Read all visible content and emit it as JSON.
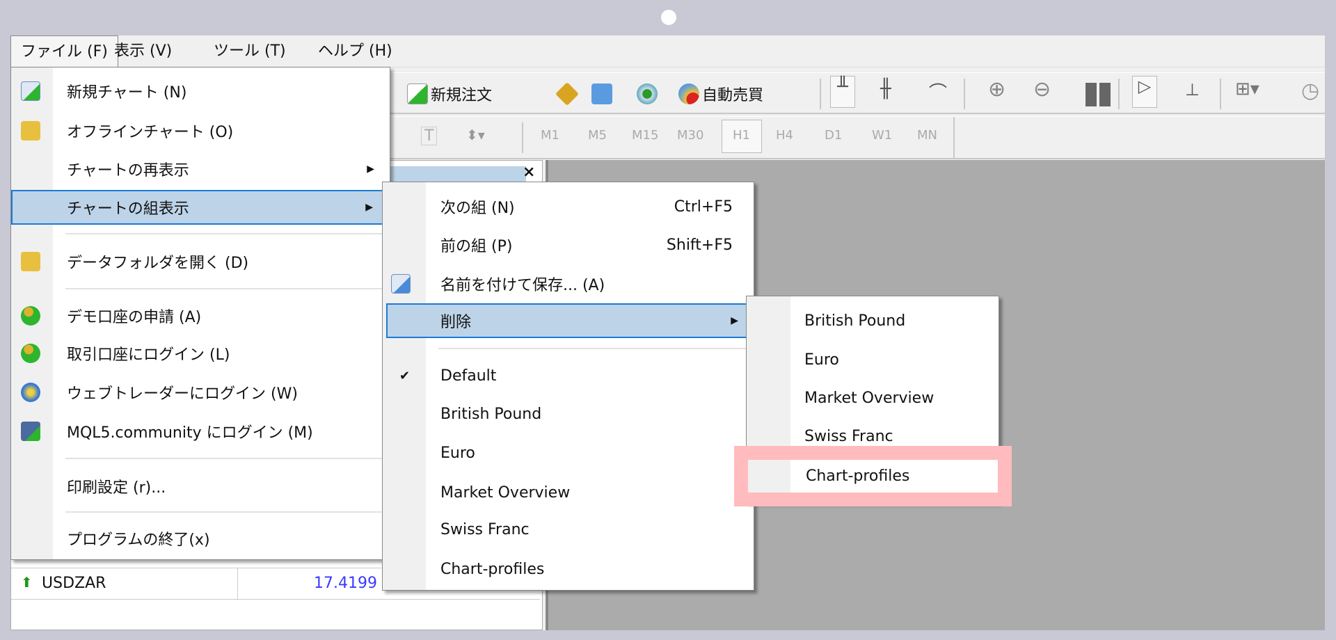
{
  "menubar": {
    "items": [
      "ファイル (F)",
      "表示 (V)",
      "ツール (T)",
      "ヘルプ (H)"
    ]
  },
  "toolbar": {
    "new_order": "新規注文",
    "auto_trade": "自動売買",
    "timeframes": [
      "M1",
      "M5",
      "M15",
      "M30",
      "H1",
      "H4",
      "D1",
      "W1",
      "MN"
    ],
    "active_timeframe": "H1"
  },
  "market_watch": {
    "close": "×",
    "rows": [
      {
        "symbol": "USDZAR",
        "bid": "17.4199",
        "direction": "up"
      }
    ]
  },
  "file_menu": {
    "items": [
      {
        "label": "新規チャート (N)",
        "icon": "new-chart-icon"
      },
      {
        "label": "オフラインチャート (O)",
        "icon": "folder-open-icon"
      },
      {
        "label": "チャートの再表示",
        "submenu": true
      },
      {
        "label": "チャートの組表示",
        "submenu": true,
        "highlighted": true
      },
      {
        "label": "データフォルダを開く (D)",
        "icon": "folder-icon"
      },
      {
        "label": "デモ口座の申請 (A)",
        "icon": "user-add-icon"
      },
      {
        "label": "取引口座にログイン (L)",
        "icon": "user-login-icon"
      },
      {
        "label": "ウェブトレーダーにログイン (W)",
        "icon": "globe-login-icon"
      },
      {
        "label": "MQL5.community にログイン (M)",
        "icon": "mql5-login-icon"
      },
      {
        "label": "印刷設定 (r)..."
      },
      {
        "label": "プログラムの終了(x)"
      }
    ]
  },
  "profiles_menu": {
    "items": [
      {
        "label": "次の組 (N)",
        "shortcut": "Ctrl+F5"
      },
      {
        "label": "前の組 (P)",
        "shortcut": "Shift+F5"
      },
      {
        "label": "名前を付けて保存... (A)",
        "icon": "save-profile-icon"
      },
      {
        "label": "削除",
        "submenu": true,
        "highlighted": true
      },
      {
        "label": "Default",
        "checked": true
      },
      {
        "label": "British Pound"
      },
      {
        "label": "Euro"
      },
      {
        "label": "Market Overview"
      },
      {
        "label": "Swiss Franc"
      },
      {
        "label": "Chart-profiles"
      }
    ]
  },
  "delete_menu": {
    "items": [
      "British Pound",
      "Euro",
      "Market Overview",
      "Swiss Franc",
      "Chart-profiles"
    ],
    "emphasized": "Chart-profiles"
  },
  "colors": {
    "highlight": "#bdd3e8",
    "highlight_border": "#1c7ad6",
    "annotation": "#ffbbbd",
    "price_up": "#3a3aff"
  }
}
